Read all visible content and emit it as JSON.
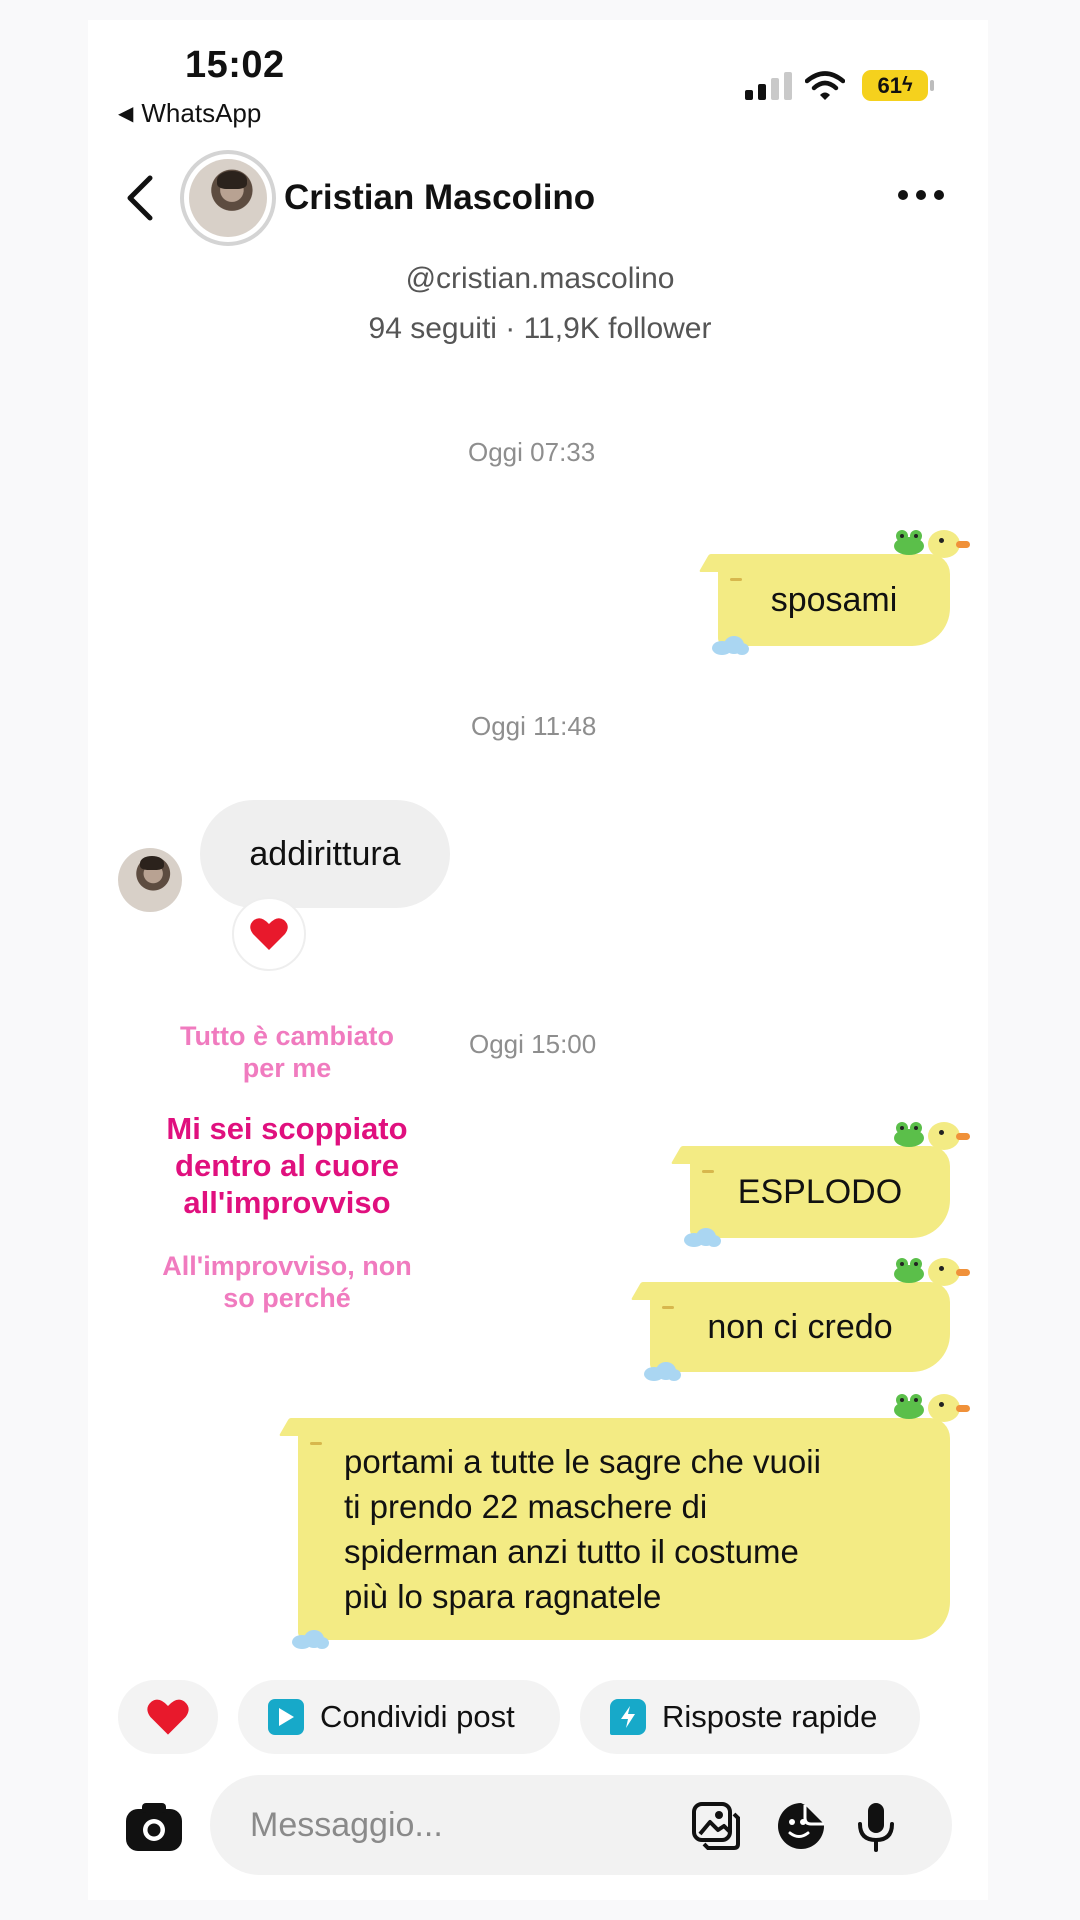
{
  "status_bar": {
    "time": "15:02",
    "back_app": "WhatsApp",
    "battery": "61"
  },
  "header": {
    "name": "Cristian Mascolino",
    "handle": "@cristian.mascolino",
    "stats": "94 seguiti · 11,9K follower"
  },
  "timestamps": [
    "Oggi 07:33",
    "Oggi 11:48",
    "Oggi 15:00"
  ],
  "messages": {
    "out_1": "sposami",
    "in_1": "addirittura",
    "in_1_reaction": "❤️",
    "out_2": "ESPLODO",
    "out_3": "non ci credo",
    "out_4": "portami a tutte le sagre che vuoii\nti prendo 22 maschere di\nspiderman anzi tutto il costume\npiù lo spara ragnatele"
  },
  "lyrics": {
    "line1": "Tutto è cambiato\nper me",
    "line2": "Mi sei scoppiato\ndentro al cuore\nall'improvviso",
    "line3": "All'improvviso, non\nso perché"
  },
  "quick_actions": {
    "share_post": "Condividi post",
    "quick_replies": "Risposte rapide"
  },
  "composer": {
    "placeholder": "Messaggio..."
  },
  "colors": {
    "bubble_out": "#f3eb84",
    "bubble_in": "#efefef",
    "lyric_light": "#f07bbf",
    "lyric_strong": "#e0107e",
    "battery": "#f5d11d"
  }
}
